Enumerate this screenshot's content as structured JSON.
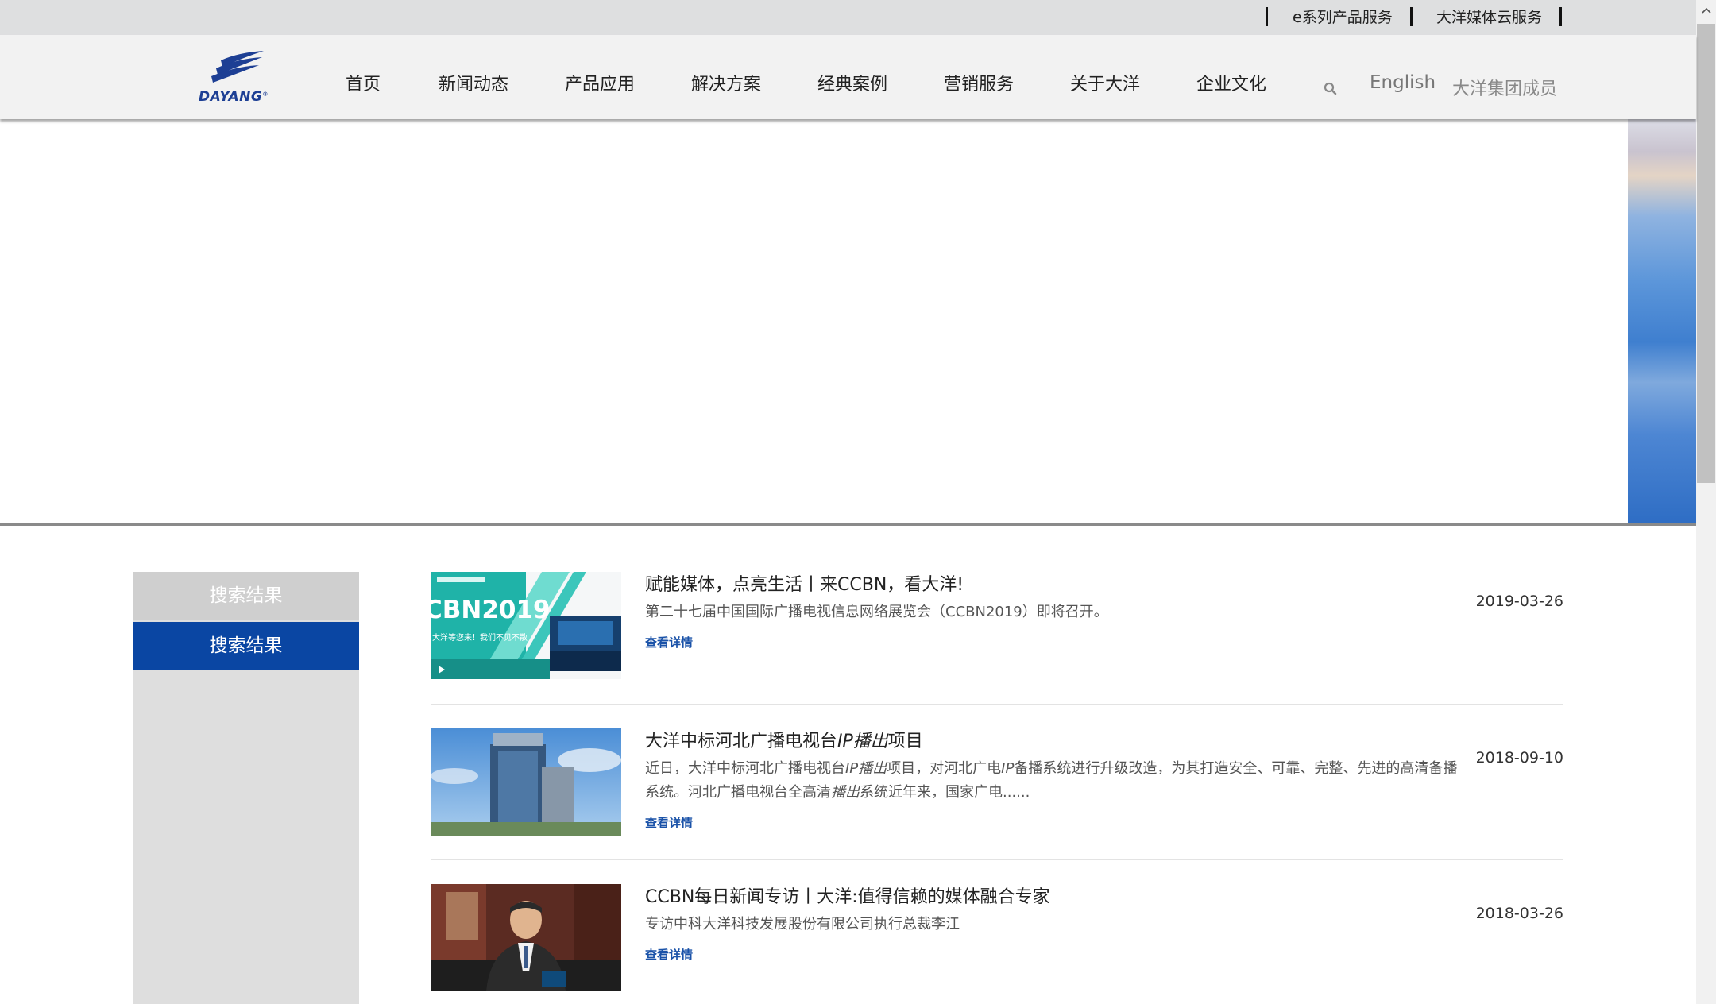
{
  "topbar": {
    "links": [
      "e系列产品服务",
      "大洋媒体云服务"
    ]
  },
  "header": {
    "logo_text": "DAYANG",
    "logo_mark": "®",
    "nav": [
      "首页",
      "新闻动态",
      "产品应用",
      "解决方案",
      "经典案例",
      "营销服务",
      "关于大洋",
      "企业文化"
    ],
    "language": "English",
    "group_link": "大洋集团成员"
  },
  "sidebar": {
    "heading": "搜索结果",
    "active_item": "搜索结果"
  },
  "results": [
    {
      "title": "赋能媒体，点亮生活丨来CCBN，看大洋!",
      "desc": "第二十七届中国国际广播电视信息网络展览会（CCBN2019）即将召开。",
      "more": "查看详情",
      "date": "2019-03-26",
      "thumb_text": "CBN2019",
      "thumb_sub": "大洋等您来！我们不见不散"
    },
    {
      "title_parts": [
        "大洋中标河北广播电视台",
        "IP播出",
        "项目"
      ],
      "desc_parts": [
        "近日，大洋中标河北广播电视台",
        "IP播出",
        "项目，对河北广电",
        "IP",
        "备播系统进行升级改造，为其打造安全、可靠、完整、先进的高清备播系统。河北广播电视台全高清",
        "播出",
        "系统近年来，国家广电......"
      ],
      "more": "查看详情",
      "date": "2018-09-10"
    },
    {
      "title": "CCBN每日新闻专访丨大洋:值得信赖的媒体融合专家",
      "desc": "专访中科大洋科技发展股份有限公司执行总裁李江",
      "more": "查看详情",
      "date": "2018-03-26"
    }
  ],
  "colors": {
    "accent": "#0a46a3",
    "link": "#1a52a8",
    "topbar_bg": "#dedfe0",
    "header_bg": "#f2f2f2",
    "sidebar_bg": "#dedede"
  },
  "icons": [
    "logo-icon",
    "search-icon",
    "scroll-up-icon"
  ]
}
